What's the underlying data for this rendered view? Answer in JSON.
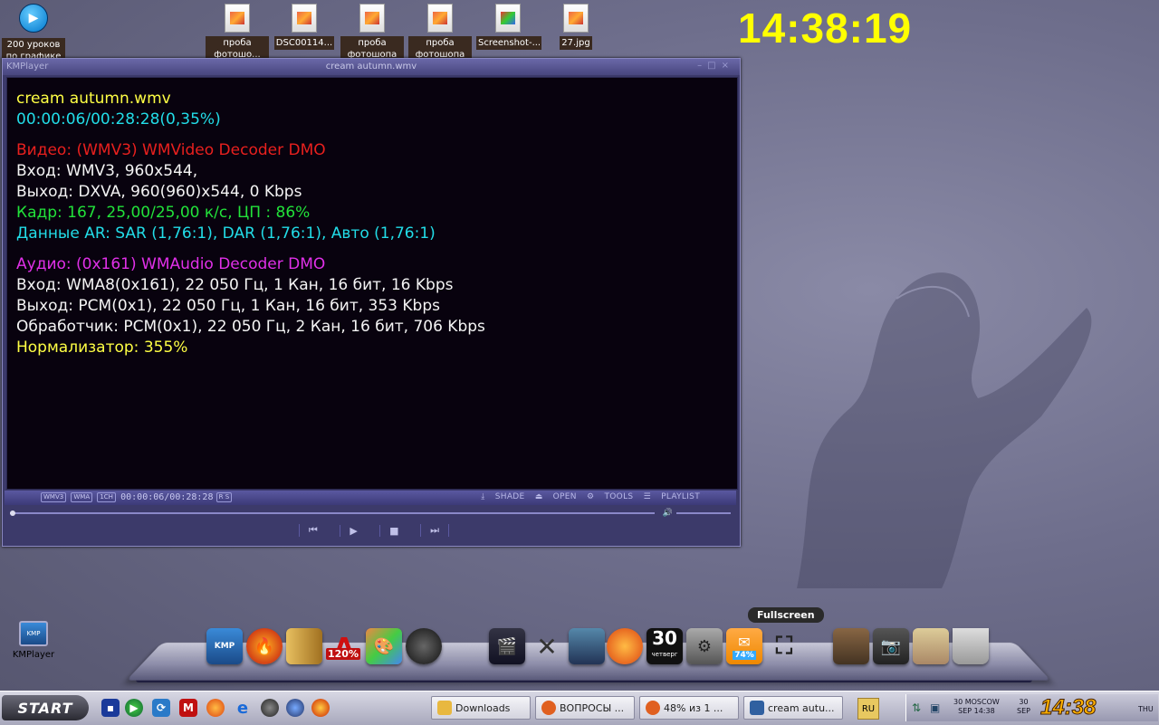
{
  "desktop": {
    "clock": "14:38:19",
    "icons": [
      {
        "label": "200 уроков по графике"
      },
      {
        "label": "проба фотошо..."
      },
      {
        "label": "DSC00114..."
      },
      {
        "label": "проба фотошопа ..."
      },
      {
        "label": "проба фотошопа ..."
      },
      {
        "label": "Screenshot-..."
      },
      {
        "label": "27.jpg"
      }
    ],
    "kmplayer_shortcut": "KMPlayer"
  },
  "kmplayer": {
    "app_name": "KMPlayer",
    "window_title": "cream autumn.wmv",
    "osd": {
      "filename": "cream autumn.wmv",
      "position": "00:00:06/00:28:28(0,35%)",
      "video_header": "Видео: (WMV3) WMVideo Decoder DMO",
      "video_in": "Вход: WMV3, 960x544,",
      "video_out": "Выход: DXVA, 960(960)x544, 0 Kbps",
      "frame": "Кадр: 167, 25,00/25,00 к/с, ЦП : 86%",
      "ar": "Данные AR: SAR (1,76:1), DAR (1,76:1), Авто (1,76:1)",
      "audio_header": "Аудио: (0x161) WMAudio Decoder DMO",
      "audio_in": "Вход: WMA8(0x161), 22 050 Гц, 1 Кан, 16 бит, 16 Kbps",
      "audio_out": "Выход: PCM(0x1), 22 050 Гц, 1 Кан, 16 бит, 353 Kbps",
      "processor": "Обработчик: PCM(0x1), 22 050 Гц, 2 Кан, 16 бит, 706 Kbps",
      "normalizer": "Нормализатор: 355%"
    },
    "status": {
      "badge_video": "WMV3",
      "badge_audio": "WMA",
      "badge_ch": "1CH",
      "time": "00:00:06/00:28:28",
      "badge_rs": "R S",
      "shade": "SHADE",
      "open": "OPEN",
      "tools": "TOOLS",
      "playlist": "PLAYLIST"
    },
    "controls": {
      "prev": "⏮",
      "play": "▶",
      "stop": "■",
      "next": "⏭"
    },
    "progress_fraction": 0.0035
  },
  "dock": {
    "tooltip": "Fullscreen",
    "calendar_day": "30",
    "calendar_weekday": "четверг",
    "badge_120": "120%",
    "percent_badge": "74%"
  },
  "taskbar": {
    "start_label": "START",
    "tasks": [
      {
        "label": "Downloads",
        "icon_color": "#e8b840"
      },
      {
        "label": "ВОПРОСЫ ...",
        "icon_color": "#e06020"
      },
      {
        "label": "48% из 1 ...",
        "icon_color": "#e06020"
      },
      {
        "label": "cream autu...",
        "icon_color": "#3060a0"
      }
    ],
    "lang": "RU",
    "tray": {
      "day": "30",
      "city": "MOSCOW",
      "month": "SEP",
      "time_small": "14:38",
      "day2": "30",
      "month2": "SEP",
      "big_time": "14:38",
      "weekday": "THU"
    }
  }
}
